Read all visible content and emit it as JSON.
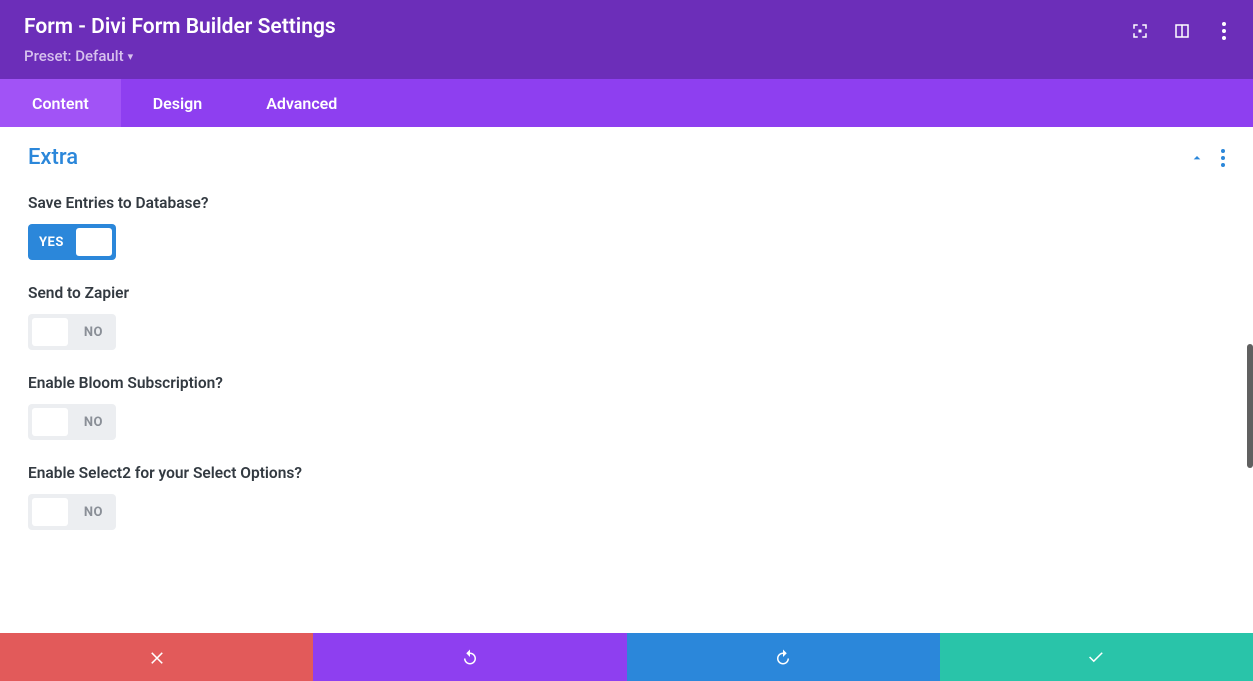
{
  "header": {
    "title": "Form - Divi Form Builder Settings",
    "preset_label": "Preset: Default"
  },
  "tabs": [
    {
      "label": "Content",
      "active": true
    },
    {
      "label": "Design",
      "active": false
    },
    {
      "label": "Advanced",
      "active": false
    }
  ],
  "section": {
    "title": "Extra"
  },
  "settings": [
    {
      "label": "Save Entries to Database?",
      "state": "yes",
      "text": "YES"
    },
    {
      "label": "Send to Zapier",
      "state": "no",
      "text": "NO"
    },
    {
      "label": "Enable Bloom Subscription?",
      "state": "no",
      "text": "NO"
    },
    {
      "label": "Enable Select2 for your Select Options?",
      "state": "no",
      "text": "NO"
    }
  ],
  "colors": {
    "header_bg": "#6c2eb9",
    "tabs_bg": "#8e3ff0",
    "tab_active": "#a153f6",
    "accent_blue": "#2b87da",
    "cancel": "#e25a5a",
    "save": "#29c4a9"
  }
}
